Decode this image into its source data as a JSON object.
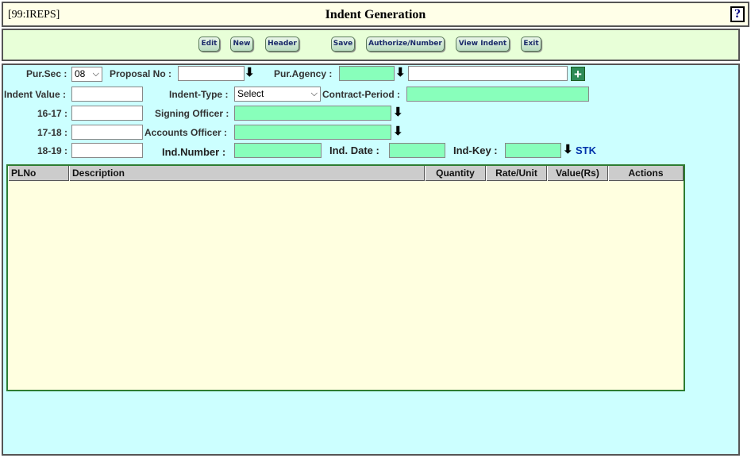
{
  "titlebar": {
    "code": "[99:IREPS]",
    "title": "Indent Generation",
    "help": "?"
  },
  "toolbar": {
    "edit": "Edit",
    "new": "New",
    "header": "Header",
    "save": "Save",
    "authorize": "Authorize/Number",
    "view_indent": "View Indent",
    "exit": "Exit"
  },
  "form": {
    "pur_sec_label": "Pur.Sec :",
    "pur_sec_value": "08",
    "proposal_no_label": "Proposal No :",
    "proposal_no_value": "",
    "pur_agency_label": "Pur.Agency :",
    "pur_agency_code": "",
    "pur_agency_name": "",
    "indent_value_label": "Indent Value :",
    "indent_value": "",
    "indent_type_label": "Indent-Type :",
    "indent_type_value": "Select",
    "contract_period_label": "Contract-Period :",
    "contract_period_value": "",
    "y1617_label": "16-17 :",
    "y1617_value": "",
    "signing_officer_label": "Signing Officer :",
    "signing_officer_value": "",
    "y1718_label": "17-18 :",
    "y1718_value": "",
    "accounts_officer_label": "Accounts Officer :",
    "accounts_officer_value": "",
    "y1819_label": "18-19 :",
    "y1819_value": "",
    "ind_number_label": "Ind.Number :",
    "ind_number_value": "",
    "ind_date_label": "Ind. Date :",
    "ind_date_value": "",
    "ind_key_label": "Ind-Key :",
    "ind_key_value": "",
    "stk": "STK",
    "arrow_glyph": "⬇",
    "plus_glyph": "+",
    "chevron": "⌵"
  },
  "grid": {
    "columns": [
      "PLNo",
      "Description",
      "Quantity",
      "Rate/Unit",
      "Value(Rs)",
      "Actions"
    ],
    "rows": []
  },
  "icons": {
    "help": "help-icon",
    "lookup": "down-arrow-icon",
    "add": "plus-icon"
  },
  "colors": {
    "title_bg": "#ffffe8",
    "toolbar_bg": "#e8ffd8",
    "panel_bg": "#ccffff",
    "lookup_field": "#88ffbb",
    "grid_bg": "#ffffe0",
    "grid_border": "#2e7d32",
    "stk": "#0033aa"
  }
}
